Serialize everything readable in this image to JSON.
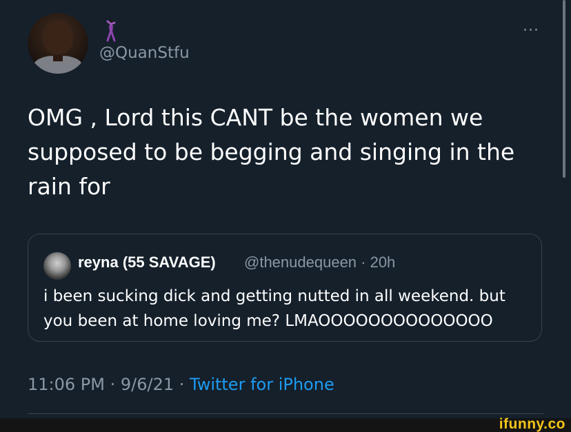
{
  "tweet": {
    "handle": "@QuanStfu",
    "emoji": "dancer-emoji",
    "more_icon": "···",
    "text": "OMG , Lord this CANT be the women we supposed to be begging and singing in the rain for"
  },
  "quote": {
    "name": "reyna (55 SAVAGE)",
    "meta": "@thenudequeen · 20h",
    "text": "i been sucking dick and getting nutted in all weekend. but you been at home loving me? LMAOOOOOOOOOOOOOO"
  },
  "footer": {
    "time_date": "11:06 PM · 9/6/21 · ",
    "source": "Twitter for iPhone"
  },
  "watermark": "ifunny.co",
  "colors": {
    "background": "#15202b",
    "secondary_text": "#8b98a5",
    "link": "#1d9bf0",
    "border": "#38444d"
  }
}
